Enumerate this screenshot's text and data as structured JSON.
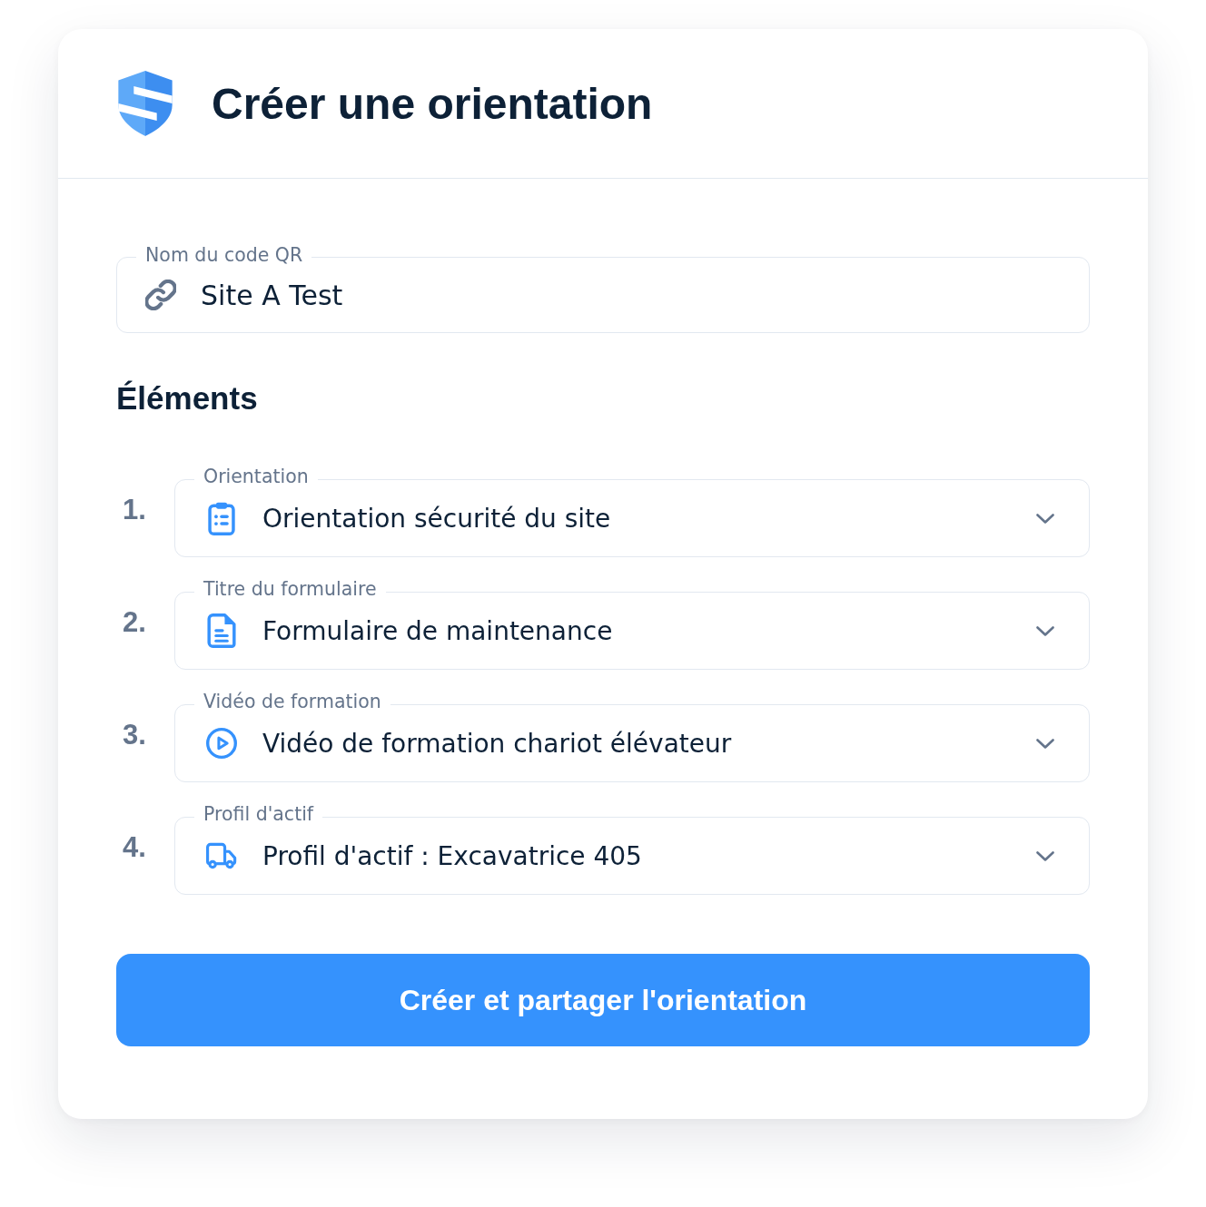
{
  "header": {
    "title": "Créer une orientation"
  },
  "qr_field": {
    "label": "Nom du code QR",
    "value": "Site A Test"
  },
  "elements": {
    "heading": "Éléments",
    "items": [
      {
        "number": "1.",
        "kind": "orientation",
        "label": "Orientation",
        "value": "Orientation sécurité du site"
      },
      {
        "number": "2.",
        "kind": "form",
        "label": "Titre du formulaire",
        "value": "Formulaire de maintenance"
      },
      {
        "number": "3.",
        "kind": "video",
        "label": "Vidéo de formation",
        "value": "Vidéo de formation chariot élévateur"
      },
      {
        "number": "4.",
        "kind": "asset",
        "label": "Profil d'actif",
        "value": "Profil d'actif : Excavatrice 405"
      }
    ]
  },
  "submit_button": {
    "label": "Créer et partager l'orientation"
  }
}
